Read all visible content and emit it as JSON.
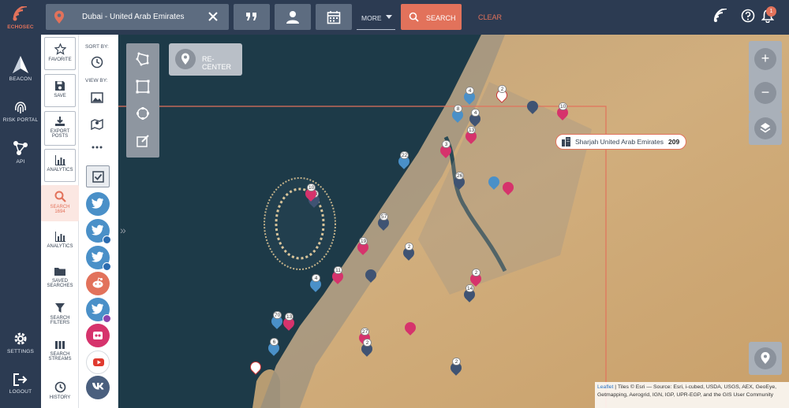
{
  "brand": {
    "name": "ECHOSEC",
    "accent": "#e2725b",
    "navy": "#2c3b52"
  },
  "leftnav": {
    "items": [
      {
        "label": "BEACON",
        "icon": "beacon-icon"
      },
      {
        "label": "RISK PORTAL",
        "icon": "fingerprint-icon"
      },
      {
        "label": "API",
        "icon": "api-icon"
      },
      {
        "label": "SETTINGS",
        "icon": "gear-icon"
      },
      {
        "label": "LOGOUT",
        "icon": "logout-icon"
      }
    ]
  },
  "topbar": {
    "location": "Dubai - United Arab Emirates",
    "more_label": "MORE",
    "search_label": "SEARCH",
    "clear_label": "CLEAR",
    "notification_count": "1"
  },
  "actions": {
    "favorite": "FAVORITE",
    "save": "SAVE",
    "export": "EXPORT POSTS",
    "analytics_box": "ANALYTICS",
    "search": "SEARCH",
    "search_count": "1694",
    "analytics": "ANALYTICS",
    "saved_searches": "SAVED SEARCHES",
    "search_filters": "SEARCH FILTERS",
    "search_streams": "SEARCH STREAMS",
    "history": "HISTORY"
  },
  "sortcol": {
    "sort_by": "SORT BY:",
    "view_by": "VIEW BY:"
  },
  "sources": [
    {
      "icon": "twitter-icon",
      "color": "#4a90c8"
    },
    {
      "icon": "twitter-geo-icon",
      "color": "#4a90c8"
    },
    {
      "icon": "twitter-facebook-icon",
      "color": "#4a90c8"
    },
    {
      "icon": "reddit-icon",
      "color": "#e2725b"
    },
    {
      "icon": "twitter-instagram-icon",
      "color": "#4a90c8"
    },
    {
      "icon": "flickr-icon",
      "color": "#d6336c"
    },
    {
      "icon": "youtube-icon",
      "color": "#ffffff"
    },
    {
      "icon": "vk-icon",
      "color": "#4a5f7e"
    }
  ],
  "map": {
    "recenter_label": "RE-CENTER",
    "zoom_in": "+",
    "zoom_out": "−",
    "region_label": "Sharjah United Arab Emirates",
    "region_count": "209",
    "attribution_link": "Leaflet",
    "attribution_text": " | Tiles © Esri — Source: Esri, i-cubed, USDA, USGS, AEX, GeoEye, Getmapping, Aerogrid, IGN, IGP, UPR-EGP, and the GIS User Community",
    "markers": [
      {
        "type": "vk",
        "num": ""
      },
      {
        "type": "tw",
        "num": "4"
      },
      {
        "type": "fl",
        "num": "10"
      },
      {
        "type": "yt",
        "num": "2"
      },
      {
        "type": "tw",
        "num": "8"
      },
      {
        "type": "vk",
        "num": "4"
      },
      {
        "type": "fl",
        "num": "13"
      },
      {
        "type": "tw",
        "num": "22"
      },
      {
        "type": "fl",
        "num": "3"
      },
      {
        "type": "vk",
        "num": "26"
      },
      {
        "type": "tw",
        "num": ""
      },
      {
        "type": "fl",
        "num": ""
      },
      {
        "type": "vk",
        "num": "57"
      },
      {
        "type": "fl",
        "num": "19"
      },
      {
        "type": "vk",
        "num": "2"
      },
      {
        "type": "fl",
        "num": "11"
      },
      {
        "type": "tw",
        "num": "4"
      },
      {
        "type": "vk",
        "num": "14"
      },
      {
        "type": "fl",
        "num": "2"
      },
      {
        "type": "vk",
        "num": ""
      },
      {
        "type": "fl",
        "num": "27"
      },
      {
        "type": "vk",
        "num": "2"
      },
      {
        "type": "tw",
        "num": "70"
      },
      {
        "type": "fl",
        "num": "13"
      },
      {
        "type": "yt",
        "num": ""
      },
      {
        "type": "vk",
        "num": "2"
      },
      {
        "type": "fl",
        "num": ""
      },
      {
        "type": "tw",
        "num": "6"
      },
      {
        "type": "vk",
        "num": "58"
      },
      {
        "type": "fl",
        "num": "10"
      }
    ]
  }
}
